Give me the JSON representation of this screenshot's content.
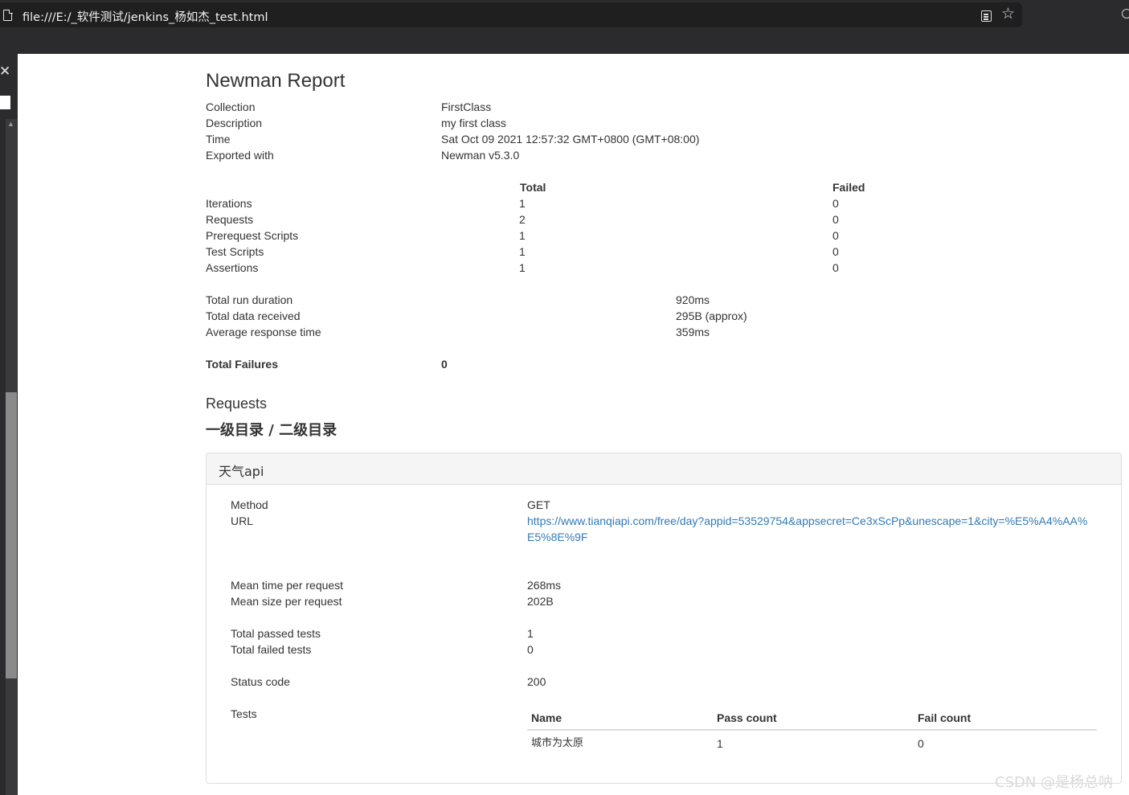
{
  "browser": {
    "url": "file:///E:/_软件测试/jenkins_杨如杰_test.html",
    "reader_icon": "reader-mode-icon",
    "star_icon": "favorite-star-icon"
  },
  "report": {
    "title": "Newman Report",
    "info": [
      {
        "label": "Collection",
        "value": "FirstClass"
      },
      {
        "label": "Description",
        "value": "my first class"
      },
      {
        "label": "Time",
        "value": "Sat Oct 09 2021 12:57:32 GMT+0800 (GMT+08:00)"
      },
      {
        "label": "Exported with",
        "value": "Newman v5.3.0"
      }
    ],
    "stats_headers": {
      "total": "Total",
      "failed": "Failed"
    },
    "stats": [
      {
        "label": "Iterations",
        "total": "1",
        "failed": "0"
      },
      {
        "label": "Requests",
        "total": "2",
        "failed": "0"
      },
      {
        "label": "Prerequest Scripts",
        "total": "1",
        "failed": "0"
      },
      {
        "label": "Test Scripts",
        "total": "1",
        "failed": "0"
      },
      {
        "label": "Assertions",
        "total": "1",
        "failed": "0"
      }
    ],
    "timings": [
      {
        "label": "Total run duration",
        "value": "920ms"
      },
      {
        "label": "Total data received",
        "value": "295B (approx)"
      },
      {
        "label": "Average response time",
        "value": "359ms"
      }
    ],
    "total_failures": {
      "label": "Total Failures",
      "value": "0"
    },
    "requests_heading": "Requests",
    "folder_title": "一级目录 / 二级目录",
    "request": {
      "name": "天气api",
      "method_label": "Method",
      "method": "GET",
      "url_label": "URL",
      "url": "https://www.tianqiapi.com/free/day?appid=53529754&appsecret=Ce3xScPp&unescape=1&city=%E5%A4%AA%E5%8E%9F",
      "mean_time_label": "Mean time per request",
      "mean_time": "268ms",
      "mean_size_label": "Mean size per request",
      "mean_size": "202B",
      "passed_label": "Total passed tests",
      "passed": "1",
      "failed_label": "Total failed tests",
      "failed": "0",
      "status_label": "Status code",
      "status": "200",
      "tests_label": "Tests",
      "tests_headers": {
        "name": "Name",
        "pass": "Pass count",
        "fail": "Fail count"
      },
      "tests": [
        {
          "name": "城市为太原",
          "pass": "1",
          "fail": "0"
        }
      ]
    }
  },
  "watermark": "CSDN @是杨总呐"
}
